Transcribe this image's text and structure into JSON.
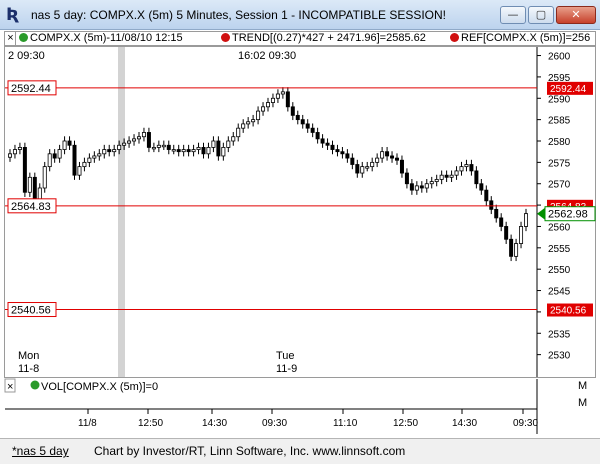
{
  "window": {
    "title": "nas 5 day: COMPX.X (5m) 5 Minutes, Session 1 - INCOMPATIBLE SESSION!",
    "minimize": "—",
    "maximize": "▢",
    "close": "✕"
  },
  "legend": {
    "close_box": "×",
    "symbol": "COMPX.X (5m)-11/08/10 12:15",
    "trend": "TREND[(0.27)*427 + 2471.96]=2585.62",
    "ref": "REF[COMPX.X (5m)]=256",
    "corner": "M"
  },
  "time_header": {
    "left": "2  09:30",
    "center": "16:02  09:30"
  },
  "price_lines": {
    "upper": "2592.44",
    "middle": "2564.83",
    "lower": "2540.56",
    "current": "2562.98",
    "right_upper": "2592.44",
    "right_middle": "2564.83",
    "right_lower": "2540.56"
  },
  "day_labels": {
    "mon": "Mon",
    "mon_date": "11-8",
    "tue": "Tue",
    "tue_date": "11-9"
  },
  "volume": {
    "close_box": "×",
    "label": "VOL[COMPX.X (5m)]=0",
    "corner": "M"
  },
  "footer": {
    "tab": "*nas 5 day",
    "credits": "Chart by Investor/RT, Linn Software, Inc. www.linnsoft.com"
  },
  "colors": {
    "reference_line": "#e00000",
    "current_price": "#008000",
    "bar": "#000000",
    "session_gap": "#cfcfcf"
  },
  "chart_data": {
    "type": "candlestick",
    "title": "",
    "xlabel": "",
    "ylabel": "",
    "ylim": [
      2525,
      2602
    ],
    "y_ticks": [
      2530,
      2535,
      2540,
      2545,
      2550,
      2555,
      2560,
      2565,
      2570,
      2575,
      2580,
      2585,
      2590,
      2595,
      2600
    ],
    "x_ticks": [
      "11/8",
      "12:50",
      "14:30",
      "09:30",
      "11:10",
      "12:50",
      "14:30",
      "09:30"
    ],
    "reference_lines": [
      2592.44,
      2564.83,
      2540.56
    ],
    "last_price": 2562.98,
    "close_series": [
      2577.0,
      2578.0,
      2578.5,
      2568.0,
      2571.5,
      2566.0,
      2569.0,
      2574.0,
      2577.0,
      2576.0,
      2578.0,
      2580.0,
      2579.0,
      2572.0,
      2574.0,
      2575.0,
      2576.0,
      2576.5,
      2577.0,
      2578.0,
      2577.5,
      2578.0,
      2579.0,
      2579.5,
      2580.0,
      2580.5,
      2581.0,
      2582.0,
      2578.5,
      2578.5,
      2579.0,
      2579.0,
      2578.0,
      2578.0,
      2577.5,
      2578.0,
      2577.5,
      2578.0,
      2578.5,
      2577.0,
      2578.5,
      2580.0,
      2576.5,
      2578.5,
      2580.0,
      2581.0,
      2583.0,
      2584.0,
      2584.5,
      2585.0,
      2587.0,
      2588.0,
      2589.0,
      2590.0,
      2591.0,
      2591.5,
      2588.0,
      2586.0,
      2585.0,
      2584.0,
      2583.0,
      2582.0,
      2580.5,
      2579.5,
      2579.0,
      2578.0,
      2577.5,
      2577.0,
      2576.0,
      2574.5,
      2572.5,
      2574.0,
      2574.0,
      2575.0,
      2576.0,
      2577.5,
      2576.5,
      2576.0,
      2575.5,
      2572.5,
      2570.0,
      2568.5,
      2569.5,
      2569.0,
      2570.0,
      2570.5,
      2571.0,
      2572.0,
      2571.5,
      2572.0,
      2573.0,
      2574.0,
      2574.5,
      2573.0,
      2570.0,
      2568.5,
      2566.0,
      2564.0,
      2562.0,
      2560.0,
      2557.0,
      2553.0,
      2556.0,
      2560.0,
      2563.0
    ]
  }
}
